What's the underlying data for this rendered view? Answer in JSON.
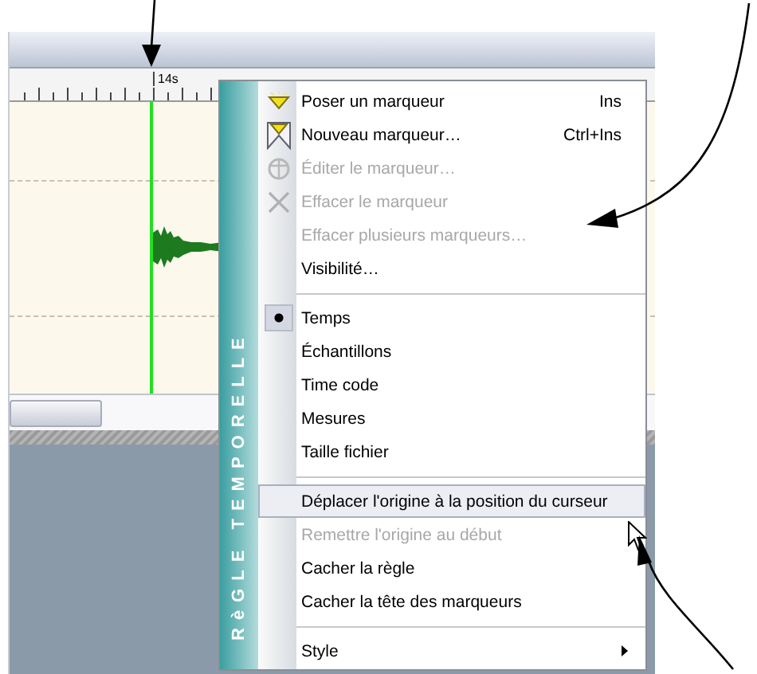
{
  "ruler": {
    "label": "14s"
  },
  "menu": {
    "title": "RèGLE TEMPORELLE",
    "items": [
      {
        "kind": "item",
        "label": "Poser un marqueur",
        "shortcut": "Ins",
        "disabled": false,
        "highlighted": false
      },
      {
        "kind": "item",
        "label": "Nouveau marqueur…",
        "shortcut": "Ctrl+Ins",
        "disabled": false,
        "highlighted": false
      },
      {
        "kind": "item",
        "label": "Éditer le marqueur…",
        "disabled": true,
        "highlighted": false
      },
      {
        "kind": "item",
        "label": "Effacer le marqueur",
        "disabled": true,
        "highlighted": false
      },
      {
        "kind": "item",
        "label": "Effacer plusieurs marqueurs…",
        "disabled": true,
        "highlighted": false
      },
      {
        "kind": "item",
        "label": "Visibilité…",
        "disabled": false,
        "highlighted": false
      },
      {
        "kind": "separator"
      },
      {
        "kind": "radio",
        "label": "Temps",
        "selected": true,
        "disabled": false,
        "highlighted": false
      },
      {
        "kind": "radio",
        "label": "Échantillons",
        "selected": false,
        "disabled": false,
        "highlighted": false
      },
      {
        "kind": "radio",
        "label": "Time code",
        "selected": false,
        "disabled": false,
        "highlighted": false
      },
      {
        "kind": "radio",
        "label": "Mesures",
        "selected": false,
        "disabled": false,
        "highlighted": false
      },
      {
        "kind": "radio",
        "label": "Taille fichier",
        "selected": false,
        "disabled": false,
        "highlighted": false
      },
      {
        "kind": "separator"
      },
      {
        "kind": "item",
        "label": "Déplacer l'origine à la position du curseur",
        "disabled": false,
        "highlighted": true
      },
      {
        "kind": "item",
        "label": "Remettre l'origine au début",
        "disabled": true,
        "highlighted": false
      },
      {
        "kind": "item",
        "label": "Cacher la règle",
        "disabled": false,
        "highlighted": false
      },
      {
        "kind": "item",
        "label": "Cacher la tête des marqueurs",
        "disabled": false,
        "highlighted": false
      },
      {
        "kind": "separator"
      },
      {
        "kind": "submenu",
        "label": "Style",
        "disabled": false,
        "highlighted": false
      }
    ]
  }
}
